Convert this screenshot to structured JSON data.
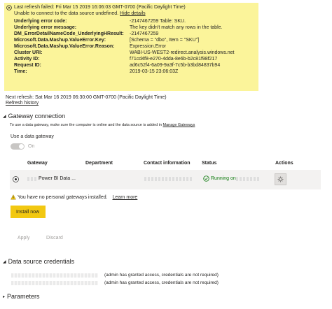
{
  "error": {
    "title": "Last refresh failed: Fri Mar 15 2019 16:06:03 GMT-0700 (Pacific Daylight Time)",
    "message": "Unable to connect to the data source undefined.",
    "hide_details": "Hide details",
    "details": [
      {
        "key": "Underlying error code:",
        "value": "-2147467259 Table: SKU."
      },
      {
        "key": "Underlying error message:",
        "value": "The key didn't match any rows in the table."
      },
      {
        "key": "DM_ErrorDetailNameCode_UnderlyingHResult:",
        "value": "-2147467259"
      },
      {
        "key": "Microsoft.Data.Mashup.ValueError.Key:",
        "value": "[Schema = \"dbo\", Item = \"SKU\"]"
      },
      {
        "key": "Microsoft.Data.Mashup.ValueError.Reason:",
        "value": "Expression.Error"
      },
      {
        "key": "Cluster URI:",
        "value": "WABI-US-WEST2-redirect.analysis.windows.net"
      },
      {
        "key": "Activity ID:",
        "value": "f71cd4f8-e270-4dda-8e6b-b2c81f98f217"
      },
      {
        "key": "Request ID:",
        "value": "ad6c52f4-6a09-9a3f-7c5b-b3bd84837b94"
      },
      {
        "key": "Time:",
        "value": "2019-03-15 23:06:03Z"
      }
    ]
  },
  "next_refresh": "Next refresh: Sat Mar 16 2019 06:30:00 GMT-0700 (Pacific Daylight Time)",
  "refresh_history": "Refresh history",
  "gateway": {
    "section_title": "Gateway connection",
    "description": "To use a data gateway, make sure the computer is online and the data source is added in",
    "manage_link": "Manage Gateways",
    "use_label": "Use a data gateway",
    "toggle_label": "On",
    "columns": [
      "Gateway",
      "Department",
      "Contact information",
      "Status",
      "Actions"
    ],
    "row": {
      "gateway": "Power BI Data ...",
      "status": "Running on"
    },
    "warning_text": "You have no personal gateways installed.",
    "learn_more": "Learn more",
    "install_label": "Install now",
    "apply_label": "Apply",
    "discard_label": "Discard"
  },
  "credentials": {
    "section_title": "Data source credentials",
    "items": [
      {
        "status": "(admin has granted access, credentials are not required)"
      },
      {
        "status": "(admin has granted access, credentials are not required)"
      }
    ]
  },
  "parameters": {
    "section_title": "Parameters"
  },
  "colors": {
    "error_bg": "#fbf49a",
    "install_btn": "#f2c811",
    "status_green": "#107c10",
    "warning": "#f2c811"
  }
}
